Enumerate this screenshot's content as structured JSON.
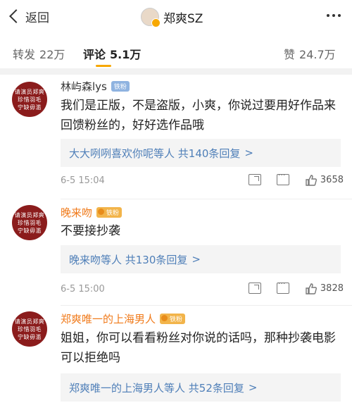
{
  "header": {
    "back_label": "返回",
    "title": "郑爽SZ"
  },
  "tabs": [
    {
      "label": "转发",
      "count": "22万"
    },
    {
      "label": "评论",
      "count": "5.1万"
    },
    {
      "label": "赞",
      "count": "24.7万"
    }
  ],
  "avatar_text": [
    "请演员郑爽",
    "珍惜羽毛",
    "宁缺毋滥"
  ],
  "comments": [
    {
      "name": "林屿森lys",
      "badge": "铁粉",
      "name_color": "#333333",
      "text": "我们是正版，不是盗版，小爽，你说过要用好作品来回馈粉丝的，好好选作品哦",
      "reply": "大大咧咧喜欢你呢等人  共140条回复",
      "time": "6-5 15:04",
      "likes": "3658"
    },
    {
      "name": "晚来吻",
      "badge": "铁粉",
      "name_color": "#f07a1a",
      "text": "不要接抄袭",
      "reply": "晚来吻等人  共130条回复",
      "time": "6-5 15:00",
      "likes": "3828"
    },
    {
      "name": "郑爽唯一的上海男人",
      "badge": "铁粉",
      "name_color": "#f07a1a",
      "text": "姐姐，你可以看看粉丝对你说的话吗，那种抄袭电影可以拒绝吗",
      "reply": "郑爽唯一的上海男人等人  共52条回复",
      "time": "",
      "likes": ""
    }
  ],
  "icons": {
    "back": "chevron-left-icon",
    "more": "more-dots-icon",
    "share": "share-icon",
    "comment": "comment-icon",
    "like": "thumbs-up-icon"
  },
  "colors": {
    "accent": "#f7a800",
    "link": "#4f7fb8",
    "avatar_bg": "#8b1c1c"
  }
}
